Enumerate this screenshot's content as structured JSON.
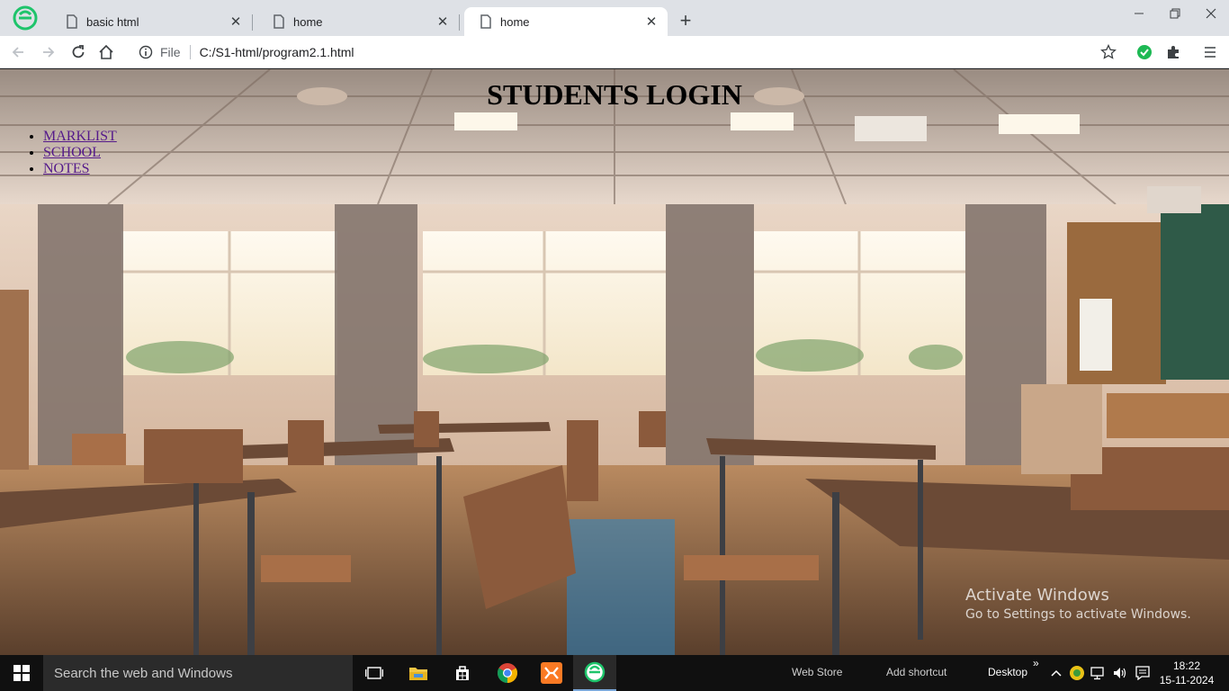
{
  "browser": {
    "tabs": [
      {
        "title": "basic html",
        "active": false
      },
      {
        "title": "home",
        "active": false
      },
      {
        "title": "home",
        "active": true
      }
    ],
    "address": {
      "scheme_label": "File",
      "url": "C:/S1-html/program2.1.html"
    },
    "accent_color": "#1a73e8"
  },
  "page": {
    "title": "STUDENTS LOGIN",
    "nav": [
      {
        "label": "MARKLIST"
      },
      {
        "label": "SCHOOL"
      },
      {
        "label": "NOTES"
      }
    ],
    "link_color": "#551a8b"
  },
  "watermark": {
    "line1": "Activate Windows",
    "line2": "Go to Settings to activate Windows."
  },
  "taskbar": {
    "search_placeholder": "Search the web and Windows",
    "web_store": "Web Store",
    "add_shortcut": "Add shortcut",
    "desktop": "Desktop",
    "time": "18:22",
    "date": "15-11-2024"
  }
}
